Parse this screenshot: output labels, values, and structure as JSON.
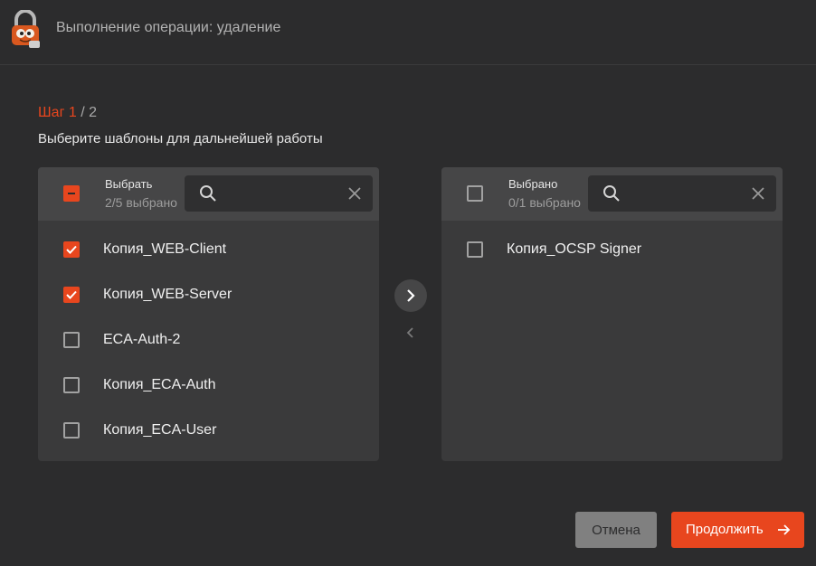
{
  "header": {
    "title": "Выполнение операции: удаление",
    "logo_icon": "padlock-mascot-icon"
  },
  "step": {
    "current": "Шаг 1",
    "separator": " / ",
    "total": "2"
  },
  "subtitle": "Выберите шаблоны для дальнейшей работы",
  "left_panel": {
    "title": "Выбрать",
    "count": "2/5 выбрано",
    "select_all_state": "partial",
    "search": {
      "value": "",
      "placeholder": ""
    },
    "items": [
      {
        "label": "Копия_WEB-Client",
        "checked": true
      },
      {
        "label": "Копия_WEB-Server",
        "checked": true
      },
      {
        "label": "ECA-Auth-2",
        "checked": false
      },
      {
        "label": "Копия_ECA-Auth",
        "checked": false
      },
      {
        "label": "Копия_ECA-User",
        "checked": false
      }
    ]
  },
  "right_panel": {
    "title": "Выбрано",
    "count": "0/1 выбрано",
    "select_all_state": "unchecked",
    "search": {
      "value": "",
      "placeholder": ""
    },
    "items": [
      {
        "label": "Копия_OCSP Signer",
        "checked": false
      }
    ]
  },
  "transfer": {
    "right_icon": "chevron-right-icon",
    "left_icon": "chevron-left-icon"
  },
  "footer": {
    "cancel_label": "Отмена",
    "continue_label": "Продолжить"
  },
  "colors": {
    "accent": "#e8461e",
    "background": "#2c2c2d",
    "panel": "#3a3a3b",
    "panel_header": "#464647"
  }
}
